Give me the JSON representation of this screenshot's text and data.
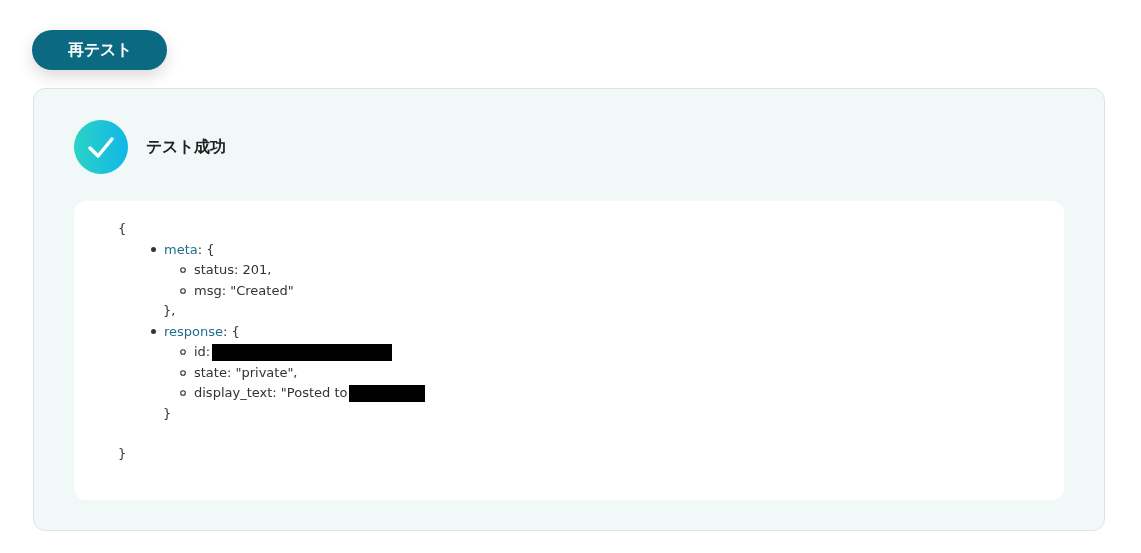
{
  "retest_button": "再テスト",
  "result": {
    "title": "テスト成功",
    "success": true
  },
  "json_view": {
    "open": "{",
    "close": "}",
    "entries": [
      {
        "key": "meta",
        "open": ": {",
        "close": "},",
        "fields": [
          {
            "text": "status: 201,"
          },
          {
            "text": "msg: \"Created\""
          }
        ]
      },
      {
        "key": "response",
        "open": ": {",
        "close": "}",
        "fields": [
          {
            "text": "id:",
            "kind": "redactedlong"
          },
          {
            "text": "state: \"private\","
          },
          {
            "text": "display_text: \"Posted to",
            "kind": "redactedshort"
          }
        ]
      }
    ]
  }
}
